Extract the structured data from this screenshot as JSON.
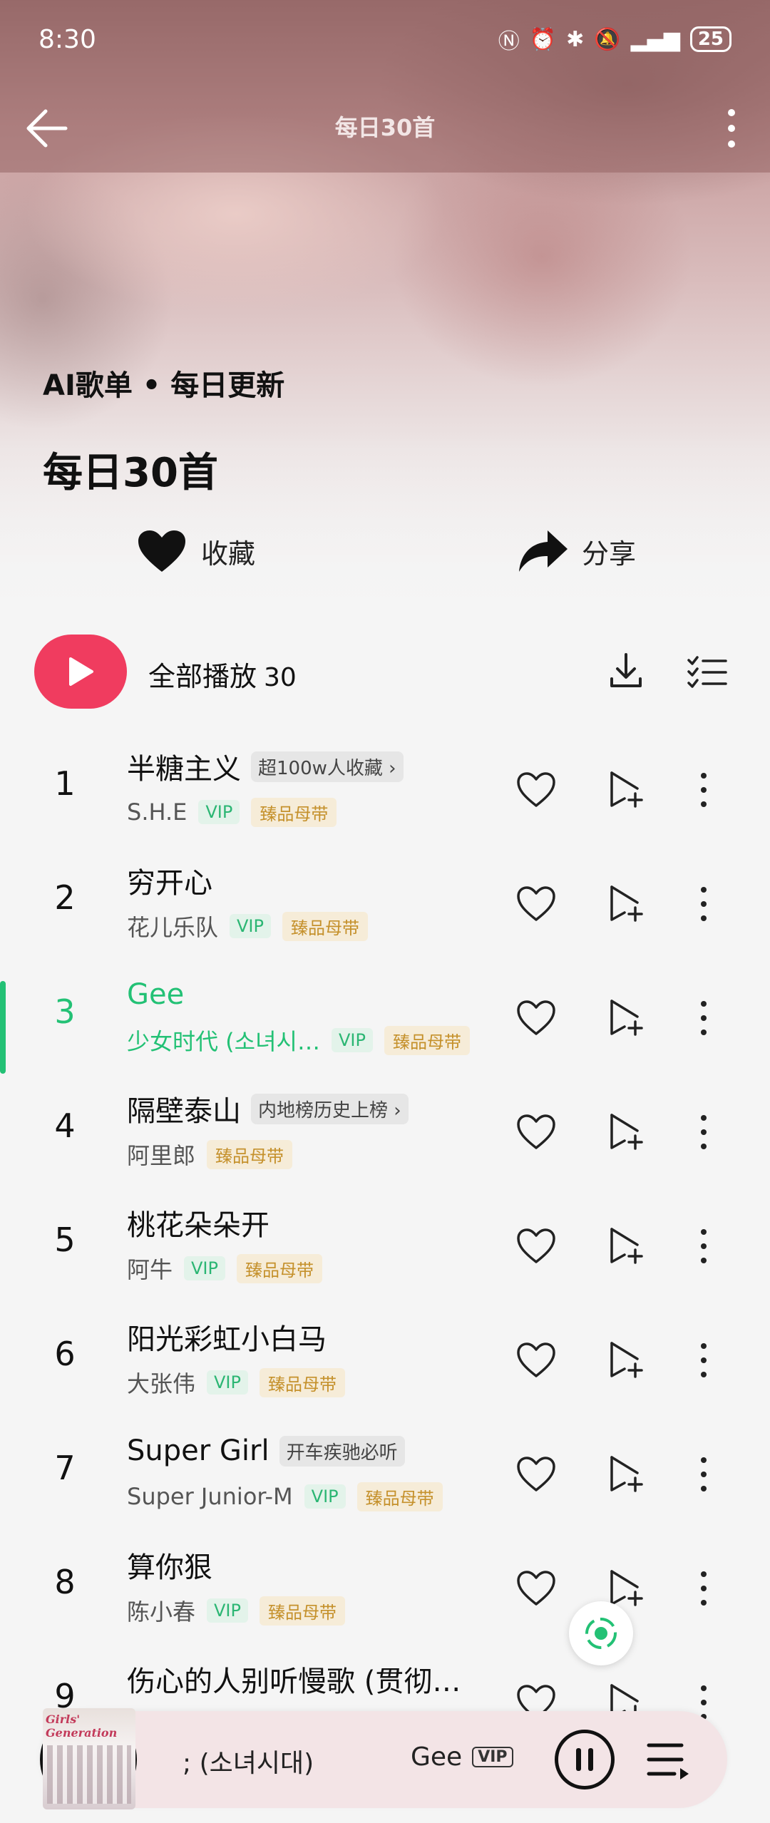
{
  "status_bar": {
    "time": "8:30",
    "icons": [
      "nfc-icon",
      "alarm-icon",
      "bluetooth-icon",
      "mute-icon",
      "signal-icon"
    ],
    "battery": "25"
  },
  "nav": {
    "title": "每日30首",
    "back_icon": "back-arrow-icon",
    "more_icon": "more-vertical-icon"
  },
  "hero": {
    "subtitle": "AI歌单 • 每日更新",
    "title": "每日30首",
    "favorite_label": "收藏",
    "share_label": "分享"
  },
  "play_all": {
    "label": "全部播放",
    "count": "30"
  },
  "colors": {
    "accent_red": "#f03c5f",
    "active_green": "#23c175",
    "vip_green": "#2bb673",
    "hq_gold": "#c5912c"
  },
  "songs": [
    {
      "index": "1",
      "title": "半糖主义",
      "tag": "超100w人收藏 ›",
      "artist": "S.H.E",
      "vip": "VIP",
      "quality": "臻品母带"
    },
    {
      "index": "2",
      "title": "穷开心",
      "tag": "",
      "artist": "花儿乐队",
      "vip": "VIP",
      "quality": "臻品母带"
    },
    {
      "index": "3",
      "title": "Gee",
      "tag": "",
      "artist": "少女时代 (소녀시…",
      "vip": "VIP",
      "quality": "臻品母带",
      "playing": true
    },
    {
      "index": "4",
      "title": "隔壁泰山",
      "tag": "内地榜历史上榜 ›",
      "artist": "阿里郎",
      "vip": "",
      "quality": "臻品母带"
    },
    {
      "index": "5",
      "title": "桃花朵朵开",
      "tag": "",
      "artist": "阿牛",
      "vip": "VIP",
      "quality": "臻品母带"
    },
    {
      "index": "6",
      "title": "阳光彩虹小白马",
      "tag": "",
      "artist": "大张伟",
      "vip": "VIP",
      "quality": "臻品母带"
    },
    {
      "index": "7",
      "title": "Super Girl",
      "tag": "开车疾驰必听",
      "artist": "Super Junior-M",
      "vip": "VIP",
      "quality": "臻品母带"
    },
    {
      "index": "8",
      "title": "算你狠",
      "tag": "",
      "artist": "陈小春",
      "vip": "VIP",
      "quality": "臻品母带"
    },
    {
      "index": "9",
      "title": "伤心的人别听慢歌 (贯彻…",
      "tag": "",
      "artist": "",
      "vip": "",
      "quality": ""
    }
  ],
  "mini_player": {
    "cover_text": "Girls' Generation",
    "artist_scroll": "; (소녀시대)",
    "song": "Gee",
    "vip": "VIP"
  }
}
